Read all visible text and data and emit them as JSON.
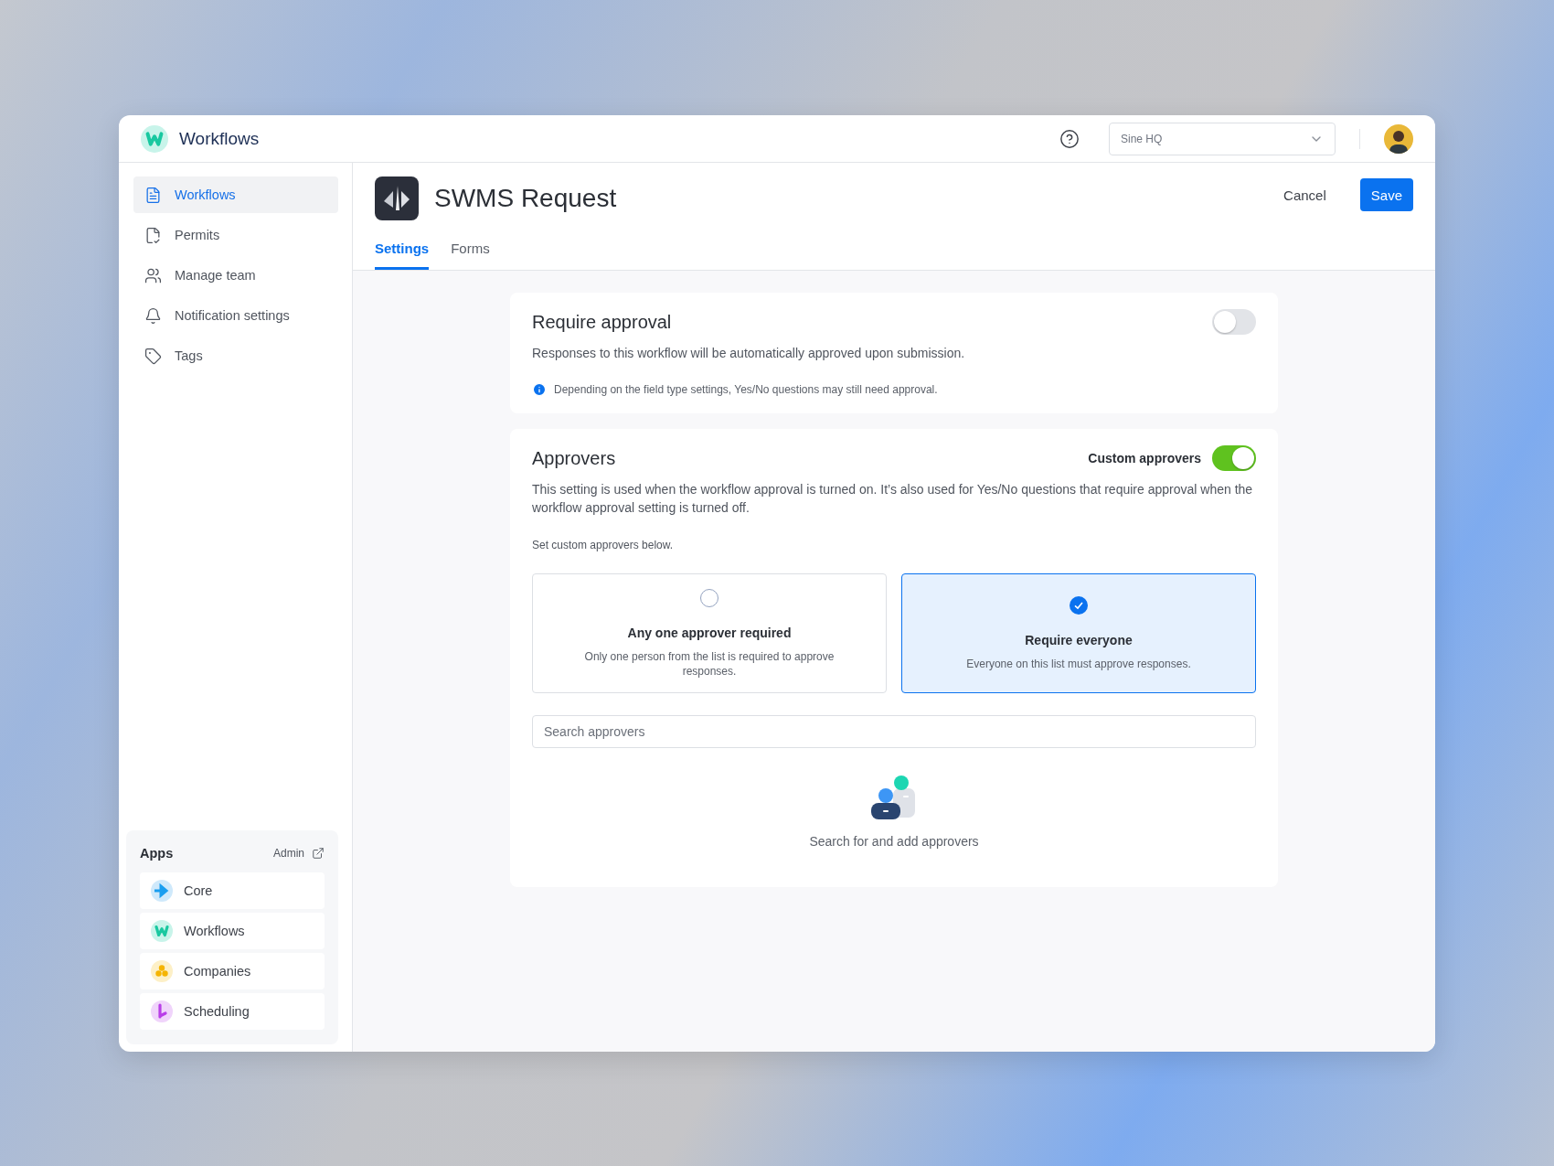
{
  "header": {
    "app_name": "Workflows",
    "org_select": {
      "value": "Sine HQ"
    }
  },
  "sidebar": {
    "items": [
      {
        "kind": "document",
        "label": "Workflows",
        "selected": true
      },
      {
        "kind": "permit",
        "label": "Permits",
        "selected": false
      },
      {
        "kind": "team",
        "label": "Manage team",
        "selected": false
      },
      {
        "kind": "bell",
        "label": "Notification settings",
        "selected": false
      },
      {
        "kind": "tag",
        "label": "Tags",
        "selected": false
      }
    ],
    "apps": {
      "title": "Apps",
      "admin_link": "Admin",
      "items": [
        {
          "kind": "core",
          "label": "Core"
        },
        {
          "kind": "workflows",
          "label": "Workflows"
        },
        {
          "kind": "companies",
          "label": "Companies"
        },
        {
          "kind": "scheduling",
          "label": "Scheduling"
        }
      ]
    }
  },
  "page": {
    "title": "SWMS Request",
    "actions": {
      "cancel": "Cancel",
      "save": "Save"
    },
    "tabs": [
      {
        "label": "Settings",
        "selected": true
      },
      {
        "label": "Forms",
        "selected": false
      }
    ]
  },
  "require_approval": {
    "title": "Require approval",
    "on": false,
    "description": "Responses to this workflow will be automatically approved upon submission.",
    "note": "Depending on the field type settings, Yes/No questions may still need approval."
  },
  "approvers": {
    "title": "Approvers",
    "toggle_label": "Custom approvers",
    "on": true,
    "description": "This setting is used when the workflow approval is turned on. It’s also used for Yes/No questions that require approval when the workflow approval setting is turned off.",
    "hint": "Set custom approvers below.",
    "options": [
      {
        "title": "Any one approver required",
        "description": "Only one person from the list is required to approve responses.",
        "selected": false
      },
      {
        "title": "Require everyone",
        "description": "Everyone on this list must approve responses.",
        "selected": true
      }
    ],
    "search": {
      "placeholder": "Search approvers"
    },
    "empty_text": "Search for and add approvers"
  }
}
